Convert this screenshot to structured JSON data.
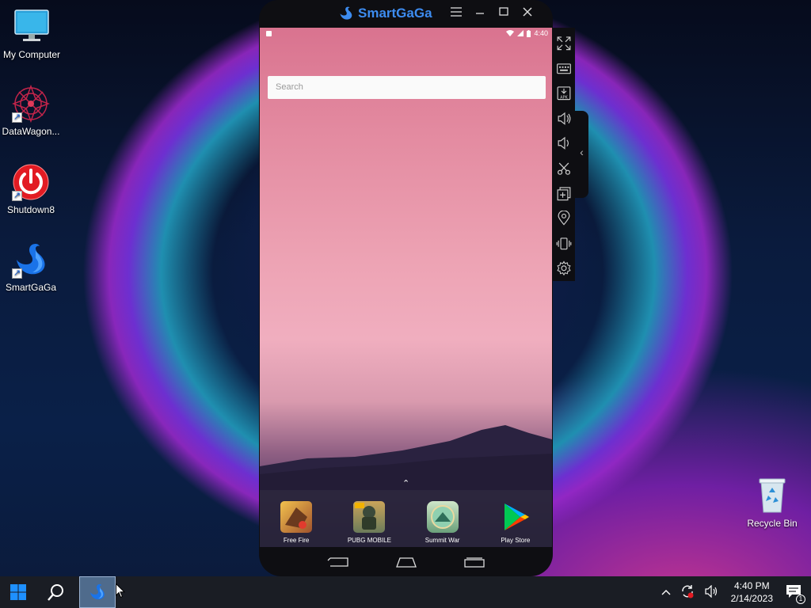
{
  "desktop": {
    "icons": [
      {
        "label": "My Computer",
        "icon": "computer-icon"
      },
      {
        "label": "DataWagon...",
        "icon": "datawagon-icon"
      },
      {
        "label": "Shutdown8",
        "icon": "power-icon"
      },
      {
        "label": "SmartGaGa",
        "icon": "swan-icon"
      },
      {
        "label": "Recycle Bin",
        "icon": "recycle-bin-icon"
      }
    ]
  },
  "emulator": {
    "title": "SmartGaGa",
    "status_time": "4:40",
    "search": {
      "placeholder": "Search"
    },
    "dock_apps": [
      {
        "label": "Free Fire",
        "icon": "free-fire-icon"
      },
      {
        "label": "PUBG MOBILE",
        "icon": "pubg-icon"
      },
      {
        "label": "Summit War",
        "icon": "summit-war-icon"
      },
      {
        "label": "Play Store",
        "icon": "play-store-icon"
      }
    ],
    "side_tools": [
      "fullscreen-icon",
      "keyboard-icon",
      "apk-install-icon",
      "volume-up-icon",
      "volume-down-icon",
      "screenshot-scissors-icon",
      "multi-instance-icon",
      "location-icon",
      "shake-icon",
      "settings-gear-icon"
    ],
    "colors": {
      "brand": "#3d8cf0",
      "frame": "#0e0e12"
    }
  },
  "taskbar": {
    "clock_time": "4:40 PM",
    "clock_date": "2/14/2023",
    "notification_count": "1"
  }
}
